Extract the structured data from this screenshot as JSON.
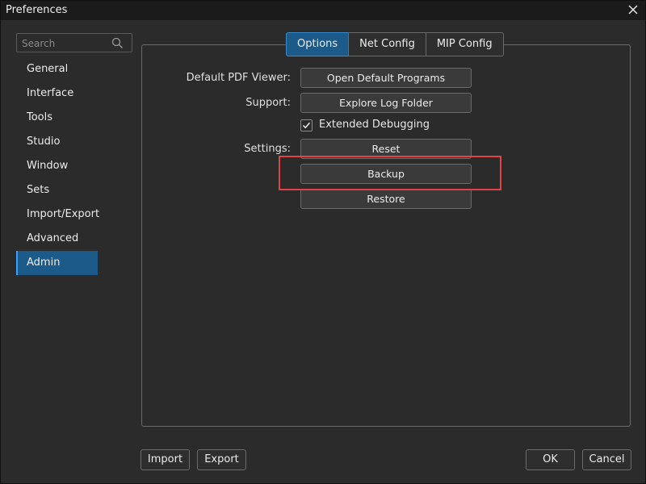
{
  "window": {
    "title": "Preferences"
  },
  "search": {
    "placeholder": "Search"
  },
  "sidebar": {
    "items": [
      {
        "label": "General"
      },
      {
        "label": "Interface"
      },
      {
        "label": "Tools"
      },
      {
        "label": "Studio"
      },
      {
        "label": "Window"
      },
      {
        "label": "Sets"
      },
      {
        "label": "Import/Export"
      },
      {
        "label": "Advanced"
      },
      {
        "label": "Admin",
        "selected": true
      }
    ]
  },
  "tabs": [
    {
      "label": "Options",
      "active": true
    },
    {
      "label": "Net Config"
    },
    {
      "label": "MIP Config"
    }
  ],
  "options": {
    "pdf_viewer_label": "Default PDF Viewer:",
    "pdf_viewer_button": "Open Default Programs",
    "support_label": "Support:",
    "support_button": "Explore Log Folder",
    "extended_debugging_label": "Extended Debugging",
    "extended_debugging_checked": true,
    "settings_label": "Settings:",
    "reset_button": "Reset",
    "backup_button": "Backup",
    "restore_button": "Restore"
  },
  "footer": {
    "import_button": "Import",
    "export_button": "Export",
    "ok_button": "OK",
    "cancel_button": "Cancel"
  },
  "colors": {
    "background": "#2b2b2b",
    "accent": "#1c5a8a",
    "highlight": "#e04444"
  }
}
